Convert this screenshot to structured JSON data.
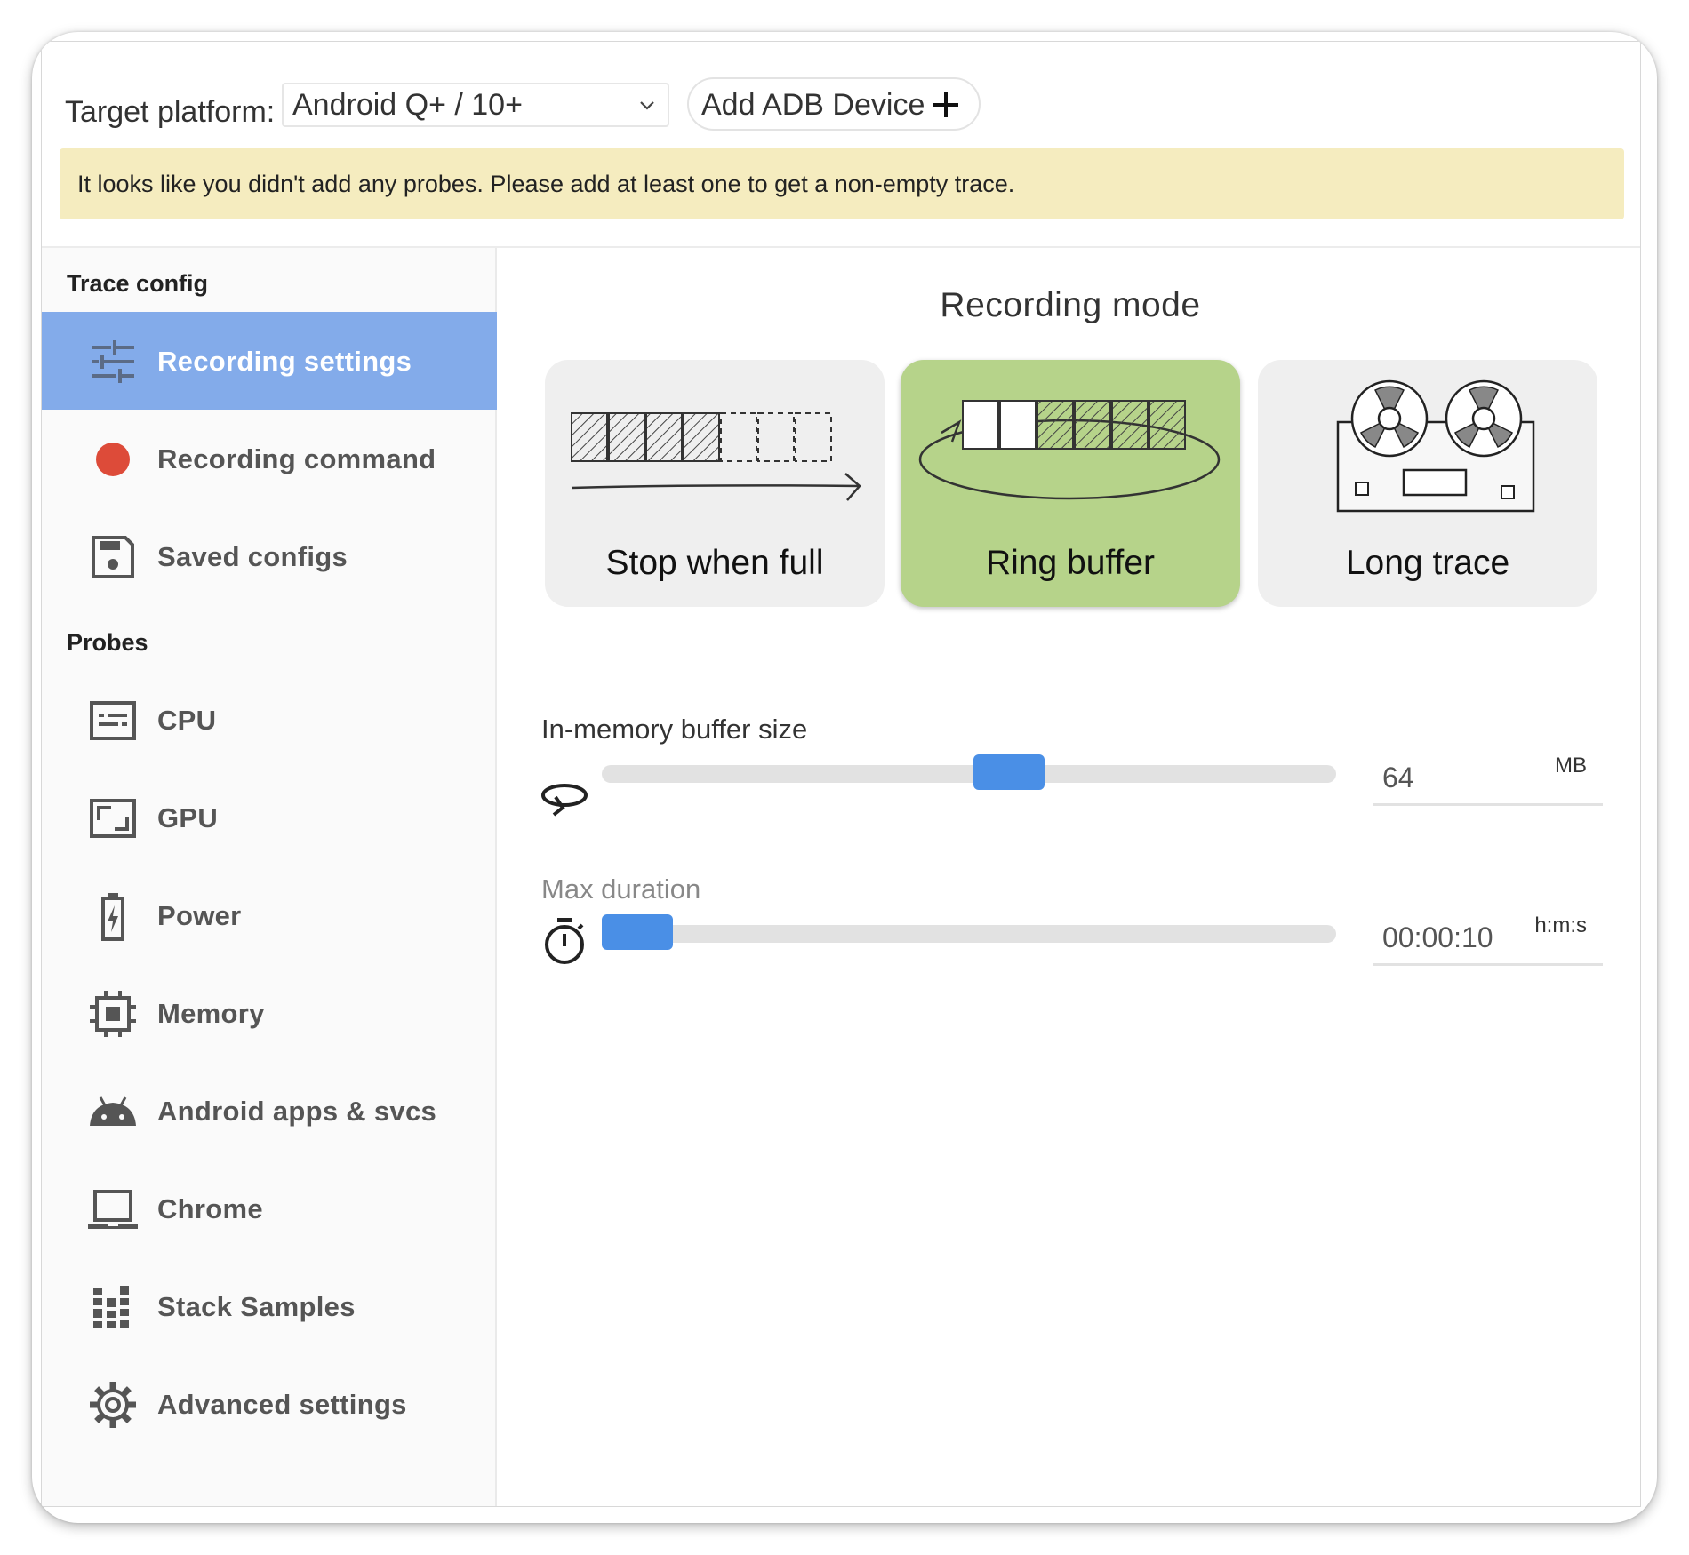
{
  "topbar": {
    "platform_label": "Target platform:",
    "platform_selected": "Android Q+ / 10+",
    "add_device_label": "Add ADB Device"
  },
  "warning": {
    "text": "It looks like you didn't add any probes. Please add at least one to get a non-empty trace."
  },
  "sidebar": {
    "trace_config_title": "Trace config",
    "trace_config_items": [
      {
        "label": "Recording settings",
        "icon": "sliders-icon",
        "active": true
      },
      {
        "label": "Recording command",
        "icon": "record-dot-icon"
      },
      {
        "label": "Saved configs",
        "icon": "save-icon"
      }
    ],
    "probes_title": "Probes",
    "probe_items": [
      {
        "label": "CPU",
        "icon": "cpu-icon"
      },
      {
        "label": "GPU",
        "icon": "gpu-icon"
      },
      {
        "label": "Power",
        "icon": "battery-icon"
      },
      {
        "label": "Memory",
        "icon": "memory-chip-icon"
      },
      {
        "label": "Android apps & svcs",
        "icon": "android-icon"
      },
      {
        "label": "Chrome",
        "icon": "laptop-icon"
      },
      {
        "label": "Stack Samples",
        "icon": "stack-samples-icon"
      },
      {
        "label": "Advanced settings",
        "icon": "gear-icon"
      }
    ]
  },
  "recording_mode": {
    "title": "Recording mode",
    "modes": [
      {
        "label": "Stop when full",
        "selected": false
      },
      {
        "label": "Ring buffer",
        "selected": true
      },
      {
        "label": "Long trace",
        "selected": false
      }
    ]
  },
  "buffer": {
    "label": "In-memory buffer size",
    "value": "64",
    "unit": "MB",
    "slider_fraction": 0.56
  },
  "duration": {
    "label": "Max duration",
    "value": "00:00:10",
    "unit": "h:m:s",
    "slider_fraction": 0.0
  },
  "colors": {
    "active_nav": "#83abea",
    "selected_mode": "#b6d38a",
    "warning_bg": "#f5ecbf",
    "slider_thumb": "#4a8fe6",
    "record_dot": "#dd4b39"
  }
}
